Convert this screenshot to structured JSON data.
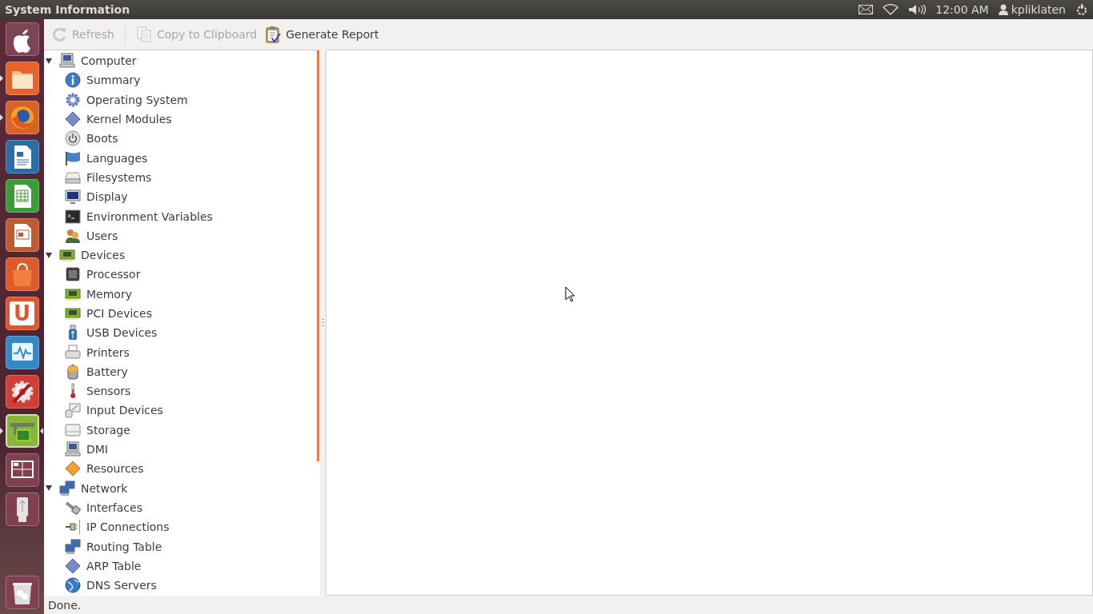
{
  "top_panel": {
    "title": "System Information",
    "clock": "12:00 AM",
    "user": "kpliklaten"
  },
  "launcher": [
    {
      "color": "#7d4453",
      "running": false,
      "focused": false
    },
    {
      "color": "#e8622a",
      "running": true,
      "focused": false
    },
    {
      "color": "#d9622b",
      "running": true,
      "focused": false
    },
    {
      "color": "#2a6ea8",
      "running": false,
      "focused": false
    },
    {
      "color": "#3c9c3a",
      "running": false,
      "focused": false
    },
    {
      "color": "#c25a30",
      "running": false,
      "focused": false
    },
    {
      "color": "#de5a2a",
      "running": false,
      "focused": false
    },
    {
      "color": "#e4532a",
      "running": false,
      "focused": false,
      "label": "U"
    },
    {
      "color": "#3389c8",
      "running": false,
      "focused": false
    },
    {
      "color": "#cf3f36",
      "running": false,
      "focused": false
    },
    {
      "color": "#8bb43c",
      "running": true,
      "focused": true
    },
    {
      "color": "#80404f",
      "running": false,
      "focused": false
    },
    {
      "color": "#80404f",
      "running": false,
      "focused": false
    }
  ],
  "trash": {
    "color": "#80404f"
  },
  "toolbar": [
    {
      "label": "Refresh",
      "disabled": true
    },
    {
      "label": "Copy to Clipboard",
      "disabled": true
    },
    {
      "label": "Generate Report",
      "disabled": false
    }
  ],
  "tree": [
    {
      "label": "Computer",
      "expanded": true,
      "children": [
        {
          "label": "Summary"
        },
        {
          "label": "Operating System"
        },
        {
          "label": "Kernel Modules"
        },
        {
          "label": "Boots"
        },
        {
          "label": "Languages"
        },
        {
          "label": "Filesystems"
        },
        {
          "label": "Display"
        },
        {
          "label": "Environment Variables"
        },
        {
          "label": "Users"
        }
      ]
    },
    {
      "label": "Devices",
      "expanded": true,
      "children": [
        {
          "label": "Processor"
        },
        {
          "label": "Memory"
        },
        {
          "label": "PCI Devices"
        },
        {
          "label": "USB Devices"
        },
        {
          "label": "Printers"
        },
        {
          "label": "Battery"
        },
        {
          "label": "Sensors"
        },
        {
          "label": "Input Devices"
        },
        {
          "label": "Storage"
        },
        {
          "label": "DMI"
        },
        {
          "label": "Resources"
        }
      ]
    },
    {
      "label": "Network",
      "expanded": true,
      "children": [
        {
          "label": "Interfaces"
        },
        {
          "label": "IP Connections"
        },
        {
          "label": "Routing Table"
        },
        {
          "label": "ARP Table"
        },
        {
          "label": "DNS Servers"
        }
      ]
    }
  ],
  "status_bar": "Done."
}
